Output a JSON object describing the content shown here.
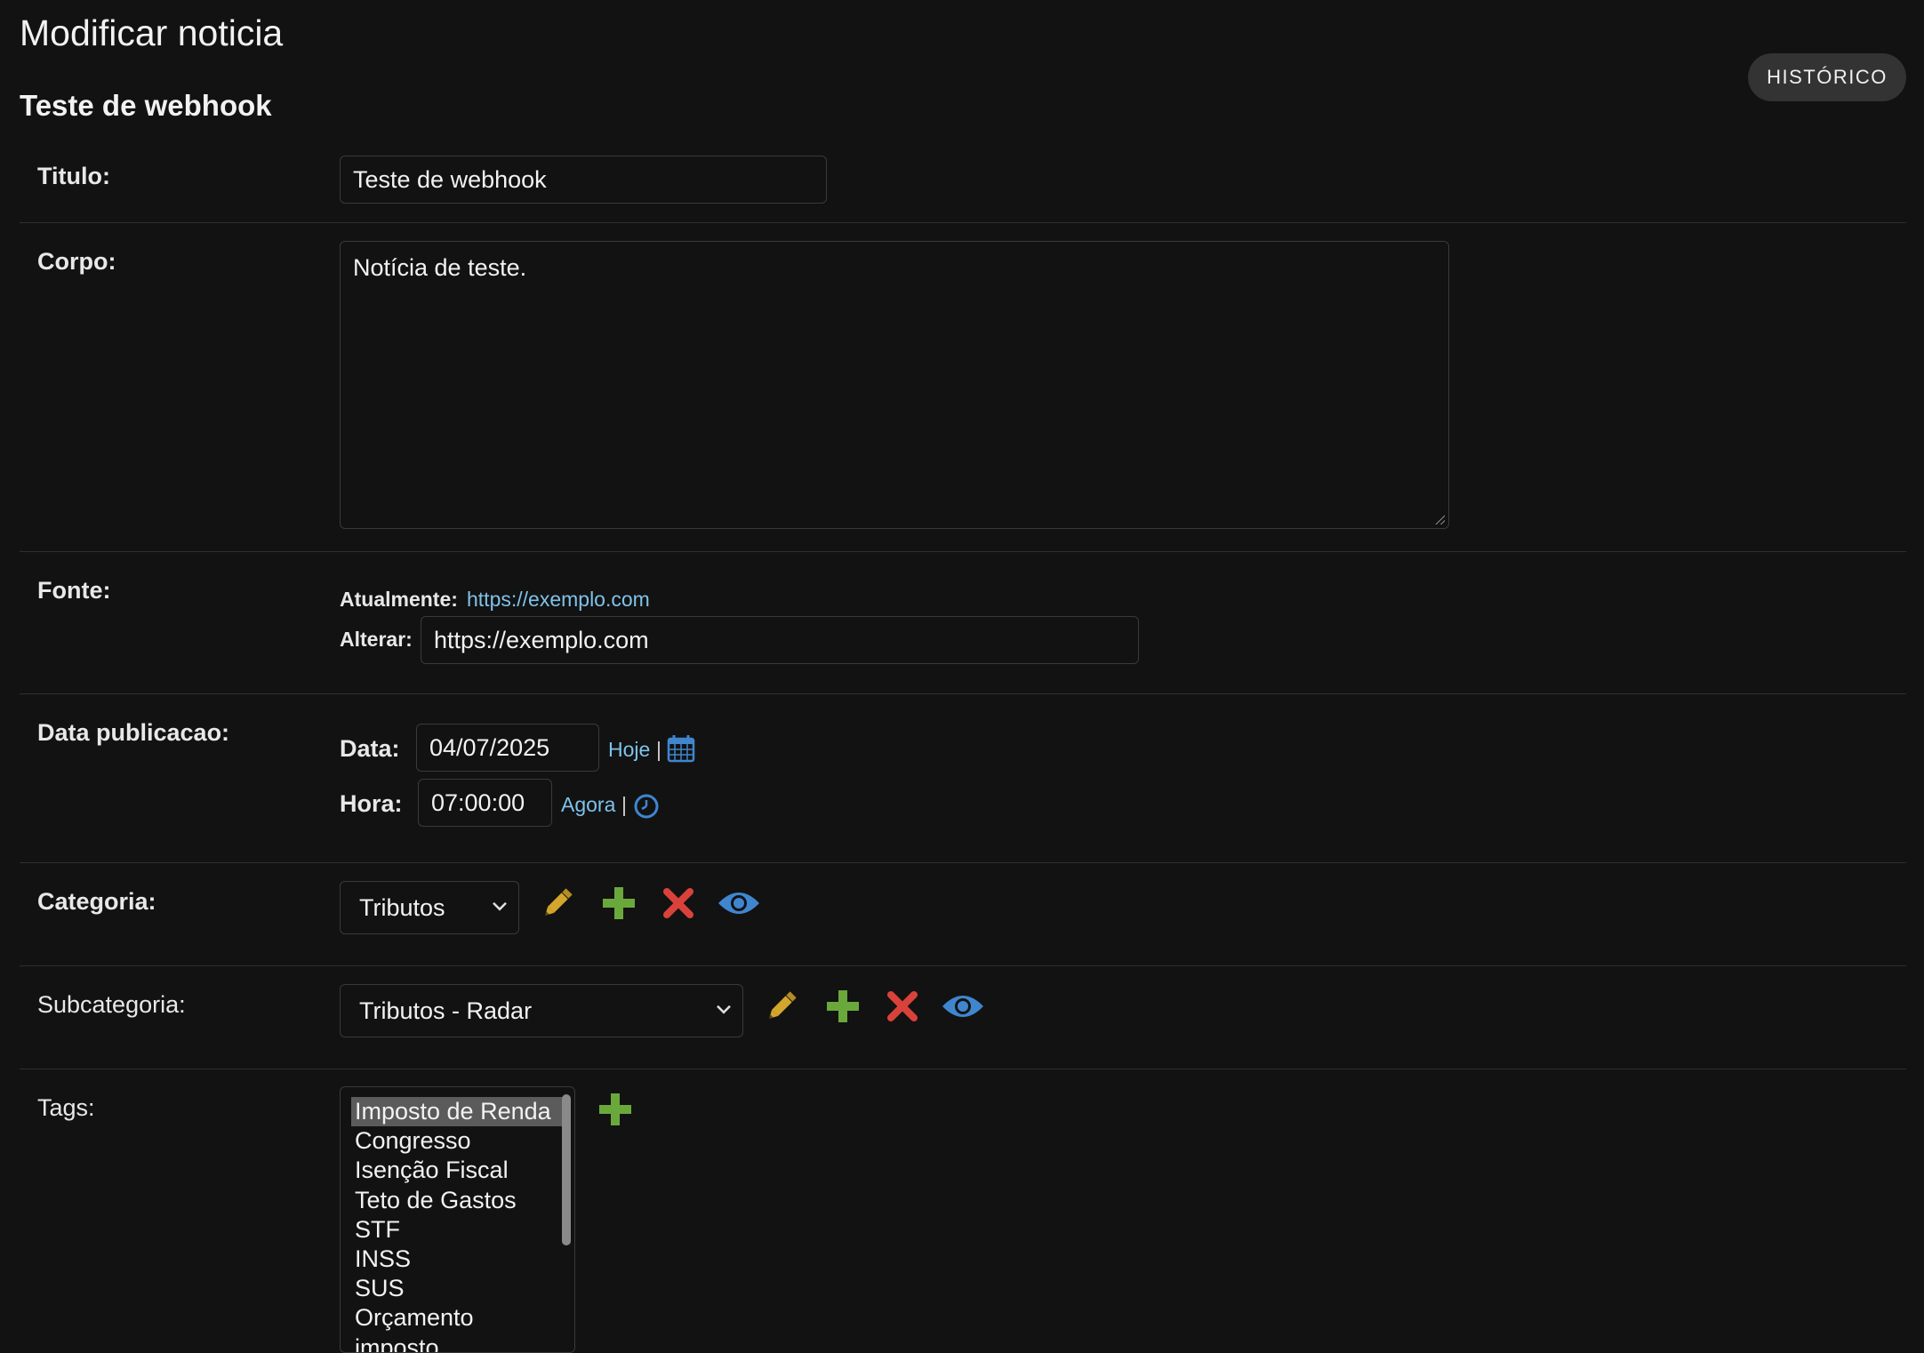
{
  "page": {
    "title": "Modificar noticia",
    "object_title": "Teste de webhook",
    "history_label": "HISTÓRICO"
  },
  "form": {
    "titulo": {
      "label": "Titulo:",
      "value": "Teste de webhook"
    },
    "corpo": {
      "label": "Corpo:",
      "value": "Notícia de teste."
    },
    "fonte": {
      "label": "Fonte:",
      "current_label": "Atualmente:",
      "current_link": "https://exemplo.com",
      "change_label": "Alterar:",
      "value": "https://exemplo.com"
    },
    "data_publicacao": {
      "label": "Data publicacao:",
      "date_label": "Data:",
      "date_value": "04/07/2025",
      "today_link": "Hoje",
      "separator": "|",
      "time_label": "Hora:",
      "time_value": "07:00:00",
      "now_link": "Agora"
    },
    "categoria": {
      "label": "Categoria:",
      "selected": "Tributos"
    },
    "subcategoria": {
      "label": "Subcategoria:",
      "selected": "Tributos - Radar"
    },
    "tags": {
      "label": "Tags:",
      "options": [
        "Imposto de Renda",
        "Congresso",
        "Isenção Fiscal",
        "Teto de Gastos",
        "STF",
        "INSS",
        "SUS",
        "Orçamento",
        "imposto"
      ],
      "selected": "Imposto de Renda"
    }
  },
  "icons": {
    "edit": "pencil-icon",
    "add": "plus-icon",
    "delete": "x-icon",
    "view": "eye-icon",
    "calendar": "calendar-icon",
    "clock": "clock-icon"
  },
  "colors": {
    "background": "#121212",
    "link": "#7fc3ea",
    "edit": "#c9a227",
    "add": "#6aa83c",
    "delete": "#d9423a",
    "view": "#3f86cf"
  }
}
